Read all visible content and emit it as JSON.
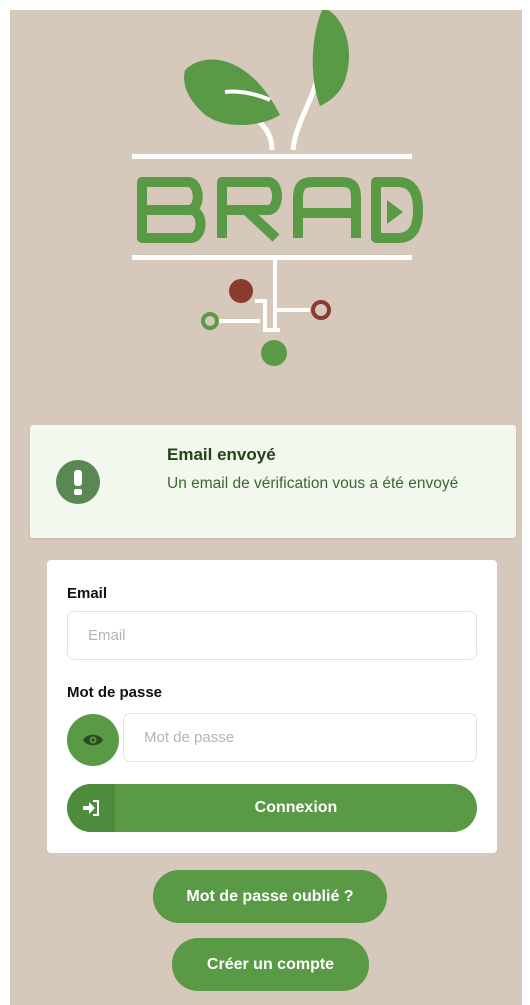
{
  "logo": {
    "text": "BRAD",
    "colors": {
      "green": "#5a9a46",
      "dark_red": "#8b3a2e",
      "white": "#ffffff"
    }
  },
  "toast": {
    "icon": "exclamation-icon",
    "title": "Email envoyé",
    "message": "Un email de vérification vous a été envoyé"
  },
  "form": {
    "email_label": "Email",
    "email_placeholder": "Email",
    "email_value": "",
    "password_label": "Mot de passe",
    "password_placeholder": "Mot de passe",
    "password_value": "",
    "show_password_icon": "eye-icon",
    "login_icon": "sign-in-icon",
    "login_label": "Connexion"
  },
  "links": {
    "forgot_password": "Mot de passe oublié ?",
    "create_account": "Créer un compte"
  },
  "theme": {
    "background": "#d6c8bb",
    "accent": "#5a9a46",
    "toast_bg": "#f3f8ef"
  }
}
